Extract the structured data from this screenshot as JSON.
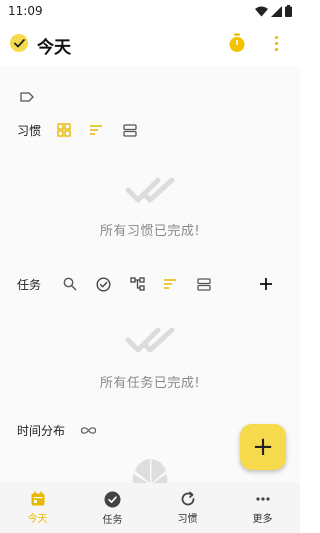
{
  "status_bar": {
    "time": "11:09"
  },
  "app_bar": {
    "title": "今天"
  },
  "sections": {
    "habits": {
      "label": "习惯",
      "empty_text": "所有习惯已完成!"
    },
    "tasks": {
      "label": "任务",
      "empty_text": "所有任务已完成!"
    },
    "time_distribution": {
      "label": "时间分布"
    }
  },
  "fab": {
    "label": "+"
  },
  "bottom_nav": [
    {
      "label": "今天",
      "icon": "calendar-icon",
      "active": true
    },
    {
      "label": "任务",
      "icon": "check-circle-icon",
      "active": false
    },
    {
      "label": "习惯",
      "icon": "refresh-icon",
      "active": false
    },
    {
      "label": "更多",
      "icon": "more-horizontal-icon",
      "active": false
    }
  ],
  "colors": {
    "accent": "#f7d94c",
    "accent_dark": "#e8b800",
    "muted_text": "#8a8a8a",
    "background": "#fafafa"
  }
}
